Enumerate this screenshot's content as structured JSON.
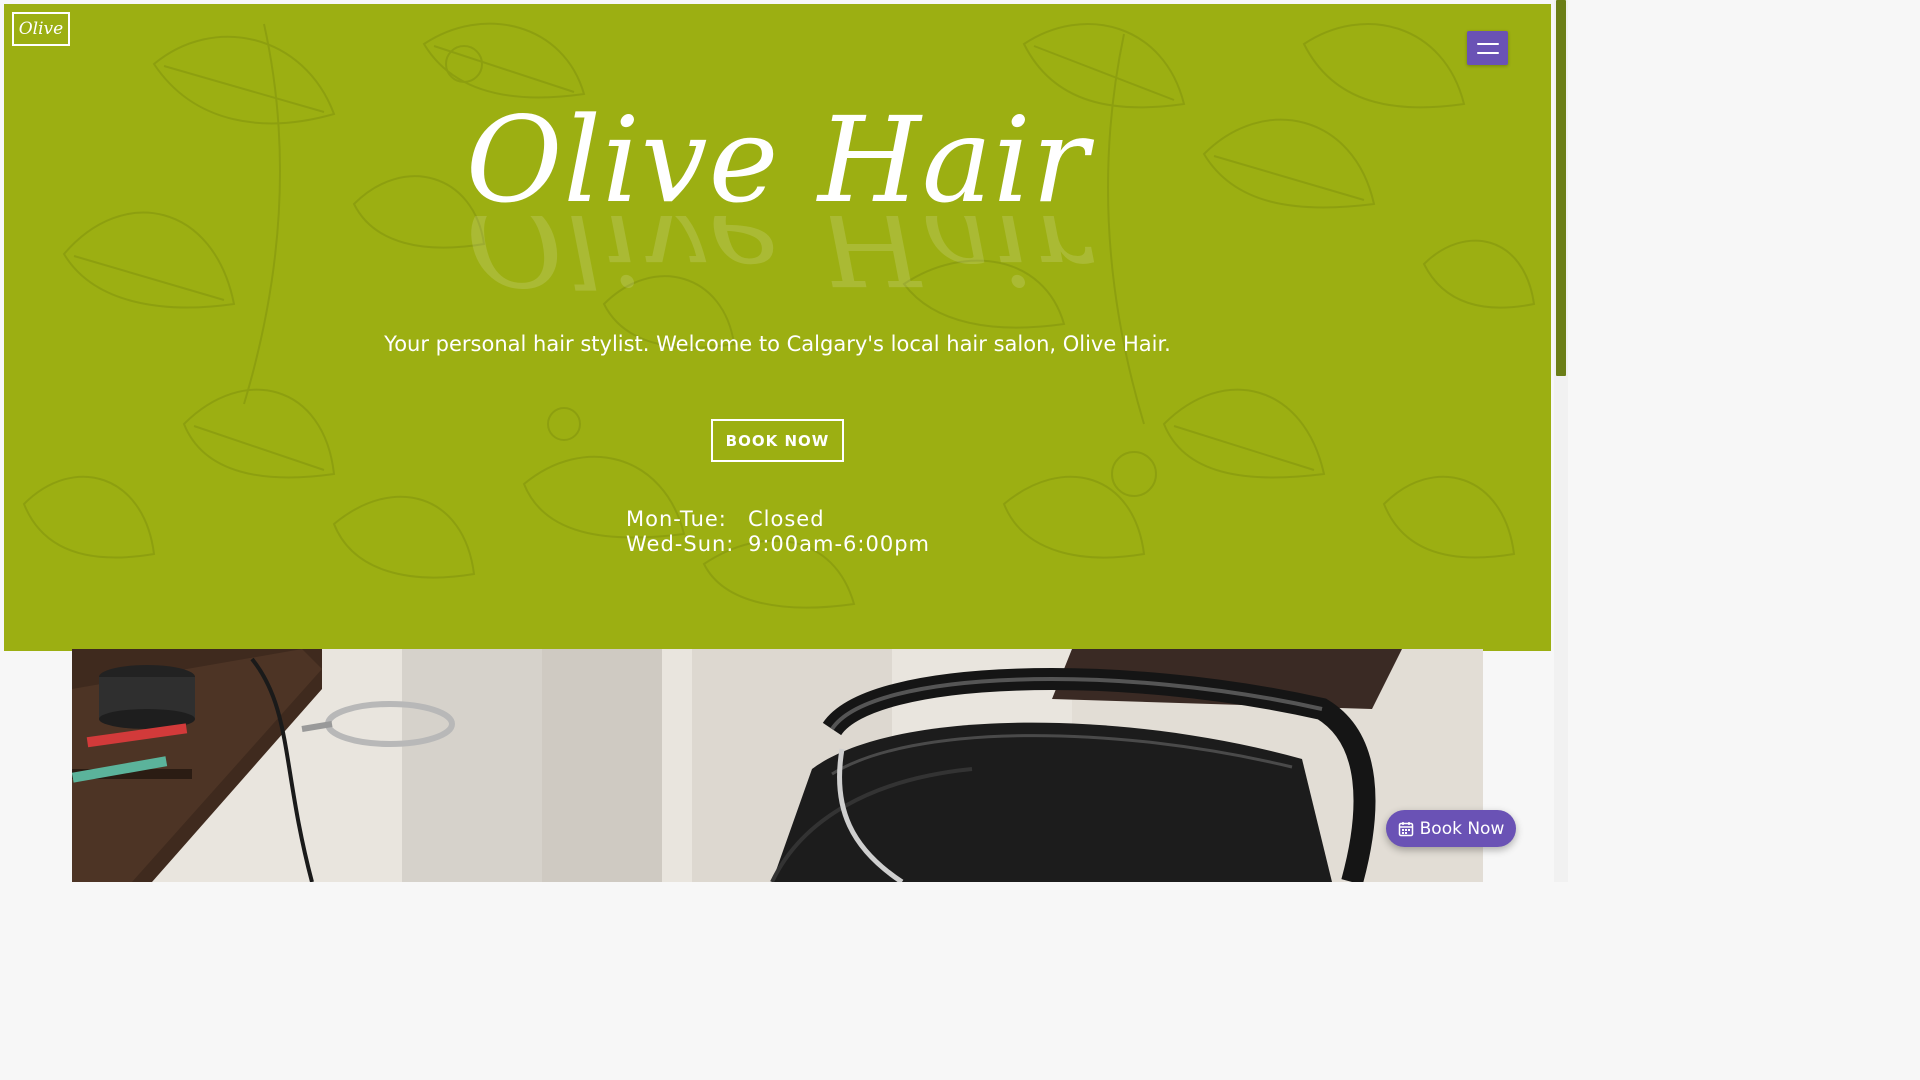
{
  "header": {
    "brand_small": "Olive",
    "menu_icon": "hamburger-icon"
  },
  "hero": {
    "title": "Olive Hair",
    "tagline": "Your personal hair stylist. Welcome to Calgary's local hair salon, Olive Hair.",
    "cta_label": "BOOK NOW",
    "hours": [
      {
        "days": "Mon-Tue:",
        "time": "Closed"
      },
      {
        "days": "Wed-Sun:",
        "time": "9:00am-6:00pm"
      }
    ]
  },
  "floating": {
    "book_label": "Book Now",
    "icon": "calendar-icon"
  },
  "colors": {
    "hero_bg": "#9caf12",
    "accent": "#6a52b5",
    "text_light": "#ffffff"
  }
}
